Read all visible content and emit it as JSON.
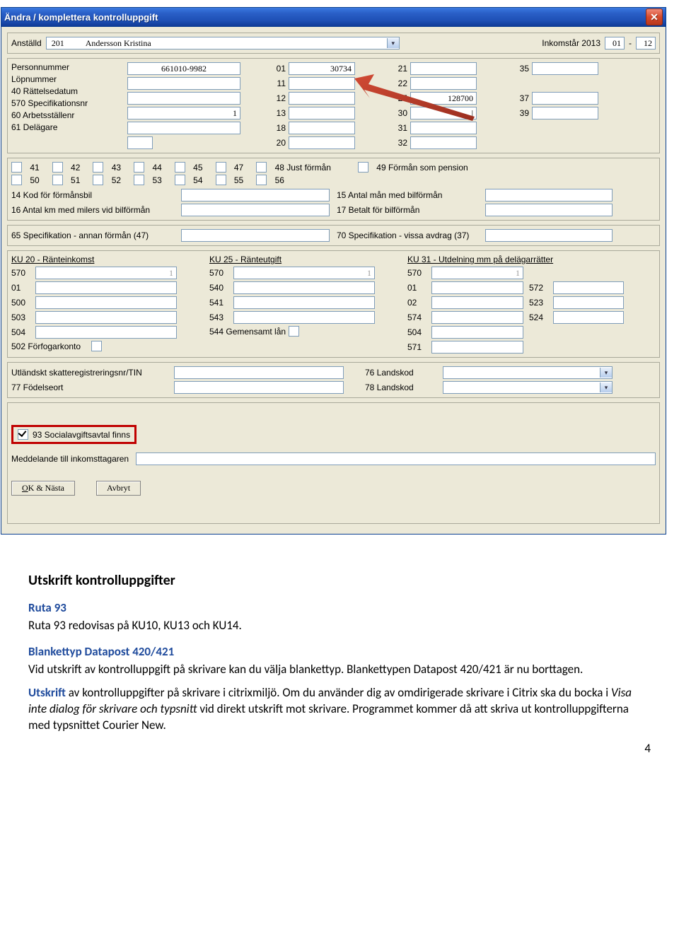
{
  "titlebar": {
    "title": "Ändra / komplettera kontrolluppgift"
  },
  "top": {
    "anstalld_lbl": "Anställd",
    "anstalld_nr": "201",
    "anstalld_namn": "Andersson Kristina",
    "inkomstar_lbl": "Inkomstår 2013",
    "from": "01",
    "sep": "-",
    "to": "12"
  },
  "left_labels": [
    "Personnummer",
    "Löpnummer",
    "40 Rättelsedatum",
    "570 Specifikationsnr",
    "60 Arbetsställenr",
    "61 Delägare"
  ],
  "left_values": [
    "661010-9982",
    "",
    "",
    "1",
    "",
    ""
  ],
  "mid1": [
    "01",
    "11",
    "12",
    "13",
    "18",
    "20"
  ],
  "mid1_vals": [
    "30734",
    "",
    "",
    "",
    "",
    ""
  ],
  "mid2": [
    "21",
    "22",
    "25",
    "30",
    "31",
    "32"
  ],
  "mid2_vals": [
    "",
    "",
    "128700",
    "|",
    "",
    ""
  ],
  "mid3": [
    "35",
    "",
    "37",
    "39",
    "",
    ""
  ],
  "mid3_vals": [
    "",
    "",
    "",
    "",
    "",
    ""
  ],
  "check_row1": [
    "41",
    "42",
    "43",
    "44",
    "45",
    "47",
    "48 Just förmån",
    "49 Förmån som pension"
  ],
  "check_row2": [
    "50",
    "51",
    "52",
    "53",
    "54",
    "55",
    "56"
  ],
  "few": {
    "l14": "14 Kod för förmånsbil",
    "l15": "15 Antal mån med bilförmån",
    "l16": "16 Antal km med milers vid bilförmån",
    "l17": "17 Betalt för bilförmån",
    "l65": "65  Specifikation - annan förmån (47)",
    "l70": "70  Specifikation - vissa avdrag (37)"
  },
  "ku20": {
    "title": "KU 20 - Ränteinkomst",
    "rows": [
      [
        "570",
        "1"
      ],
      [
        "01",
        ""
      ],
      [
        "500",
        ""
      ],
      [
        "503",
        ""
      ],
      [
        "504",
        ""
      ]
    ],
    "cb": "502 Förfogarkonto"
  },
  "ku25": {
    "title": "KU 25 - Ränteutgift",
    "rows": [
      [
        "570",
        "1"
      ],
      [
        "540",
        ""
      ],
      [
        "541",
        ""
      ],
      [
        "543",
        ""
      ]
    ],
    "cb": "544  Gemensamt lån"
  },
  "ku31": {
    "title": "KU 31 - Utdelning mm på delägarrätter",
    "left": [
      [
        "570",
        "1"
      ],
      [
        "01",
        ""
      ],
      [
        "02",
        ""
      ],
      [
        "574",
        ""
      ],
      [
        "504",
        ""
      ],
      [
        "571",
        ""
      ]
    ],
    "right": [
      "572",
      "523",
      "524"
    ]
  },
  "bottom": {
    "tin": "Utländskt skatteregistreringsnr/TIN",
    "fodelse": "77  Födelseort",
    "lk76": "76  Landskod",
    "lk78": "78  Landskod"
  },
  "cb93": "93 Socialavgiftsavtal finns",
  "medd": "Meddelande till inkomsttagaren",
  "btn_ok": "OK & Nästa",
  "btn_ok_u": "O",
  "btn_cancel": "Avbryt",
  "doc": {
    "h_utskrift": "Utskrift kontrolluppgifter",
    "h_ruta": "Ruta 93",
    "p_ruta": "Ruta 93 redovisas på KU10, KU13 och KU14.",
    "h_blank": "Blankettyp Datapost 420/421",
    "p_blank": "Vid utskrift av kontrolluppgift på skrivare kan du välja blankettyp. Blankettypen Datapost 420/421 är nu borttagen.",
    "p_citrix_lead": "Utskrift",
    "p_citrix": " av kontrolluppgifter på skrivare i citrixmiljö. Om du använder dig av omdirigerade skrivare i Citrix ska du bocka i ",
    "p_citrix_em": "Visa inte dialog för skrivare och typsnitt",
    "p_citrix2": " vid direkt utskrift mot skrivare. Programmet kommer då att skriva ut kontrolluppgifterna med typsnittet Courier New.",
    "page": "4"
  }
}
